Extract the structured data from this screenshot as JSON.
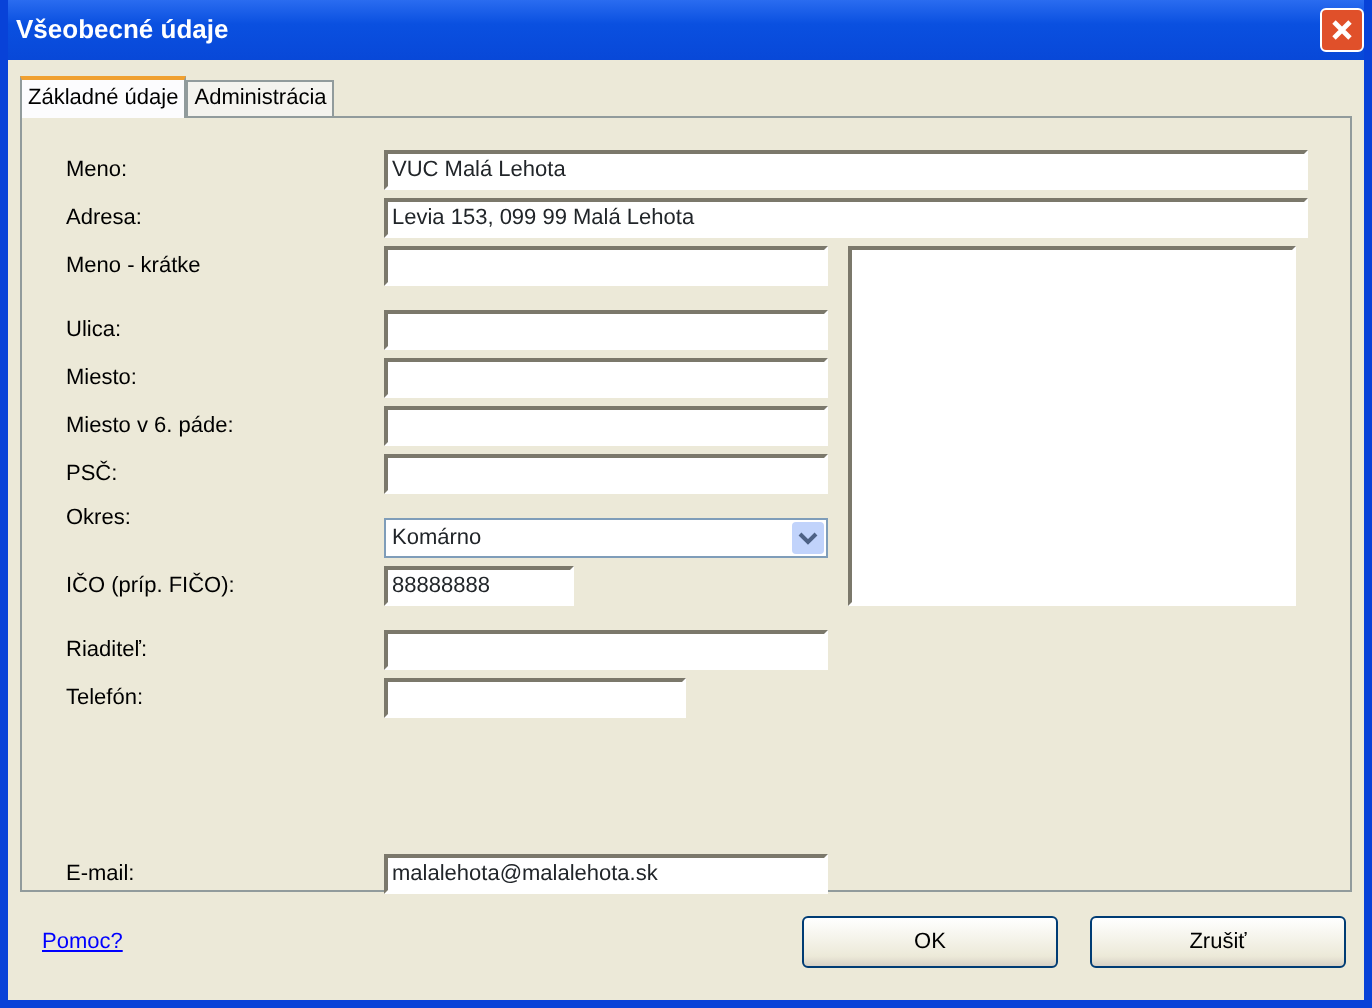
{
  "window": {
    "title": "Všeobecné údaje"
  },
  "tabs": [
    {
      "label": "Základné údaje",
      "selected": true
    },
    {
      "label": "Administrácia",
      "selected": false
    }
  ],
  "fields": [
    {
      "label": "Meno:",
      "kind": "text",
      "value": "VUC Malá Lehota"
    },
    {
      "label": "Adresa:",
      "kind": "text",
      "value": "Levia 153, 099 99 Malá Lehota"
    },
    {
      "label": "Meno - krátke",
      "kind": "text"
    },
    {
      "label": "Ulica:",
      "kind": "text"
    },
    {
      "label": "Miesto:",
      "kind": "text"
    },
    {
      "label": "Miesto v 6. páde:",
      "kind": "text"
    },
    {
      "label": "PSČ:",
      "kind": "text"
    },
    {
      "label": "Okres:",
      "kind": "select",
      "value": "Komárno"
    },
    {
      "label": "IČO (príp. FIČO):",
      "kind": "text",
      "value": "88888888"
    },
    {
      "label": "Riaditeľ:",
      "kind": "text"
    },
    {
      "label": "Telefón:",
      "kind": "text"
    },
    {
      "label": "E-mail:",
      "kind": "text",
      "value": "malalehota@malalehota.sk"
    }
  ],
  "help_link": "Pomoc?",
  "buttons": [
    "OK",
    "Zrušiť"
  ]
}
